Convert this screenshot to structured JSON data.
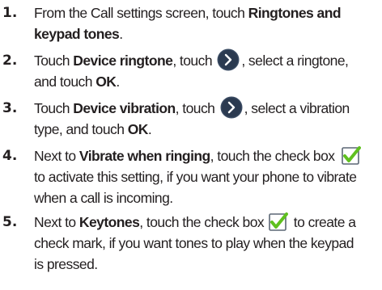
{
  "steps": [
    {
      "number": "1.",
      "lines": [
        {
          "t1": "From the Call settings screen, touch ",
          "b1": "Ringtones and"
        },
        {
          "b1": "keypad tones",
          "t1": "."
        }
      ]
    },
    {
      "number": "2.",
      "lines": [
        {
          "t1": "Touch ",
          "b1": "Device ringtone",
          "t2": ", touch ",
          "icon": "chevron-right-icon",
          "t3": ", select a ringtone,"
        },
        {
          "t1": "and touch ",
          "b1": "OK",
          "t2": "."
        }
      ]
    },
    {
      "number": "3.",
      "lines": [
        {
          "t1": "Touch ",
          "b1": "Device vibration",
          "t2": ", touch ",
          "icon": "chevron-right-icon",
          "t3": ", select a vibration"
        },
        {
          "t1": "type, and touch ",
          "b1": "OK",
          "t2": "."
        }
      ]
    },
    {
      "number": "4.",
      "lines": [
        {
          "t1": "Next to ",
          "b1": "Vibrate when ringing",
          "t2": ", touch the check box",
          "icon": "checkbox-checked-icon"
        },
        {
          "t1": "to activate this setting, if you want your phone to vibrate"
        },
        {
          "t1": "when a call is incoming."
        }
      ]
    },
    {
      "number": "5.",
      "lines": [
        {
          "t1": "Next to ",
          "b1": "Keytones",
          "t2": ", touch the check box ",
          "icon": "checkbox-checked-icon",
          "t3": " to create a"
        },
        {
          "t1": "check mark, if you want tones to play when the keypad"
        },
        {
          "t1": "is pressed."
        }
      ]
    }
  ],
  "colors": {
    "text": "#231f20",
    "chevron_button": "#3a4b63",
    "check_box_border": "#5b6775",
    "check_mark": "#5fc01f"
  }
}
